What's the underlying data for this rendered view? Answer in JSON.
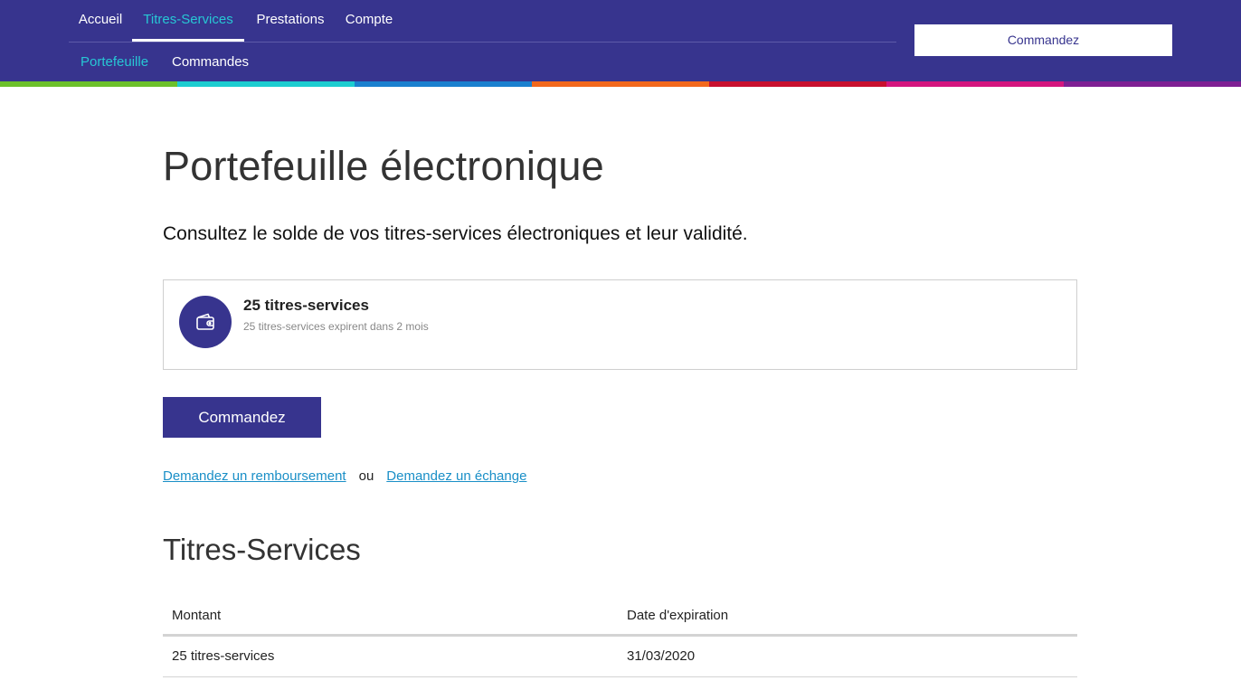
{
  "header": {
    "main_nav": [
      {
        "label": "Accueil"
      },
      {
        "label": "Titres-Services"
      },
      {
        "label": "Prestations"
      },
      {
        "label": "Compte"
      }
    ],
    "sub_nav": [
      {
        "label": "Portefeuille"
      },
      {
        "label": "Commandes"
      }
    ],
    "order_button": "Commandez",
    "active_main": "Titres-Services",
    "active_sub": "Portefeuille"
  },
  "colors": {
    "brand": "#37348e",
    "accent": "#27c7d4",
    "link": "#1a8fc7",
    "stripe": [
      "#6cc02b",
      "#1ccdd0",
      "#1a80cf",
      "#f2681c",
      "#c8102e",
      "#d4157e",
      "#7e1f93"
    ]
  },
  "main": {
    "title": "Portefeuille électronique",
    "subtitle": "Consultez le solde de vos titres-services électroniques et leur validité.",
    "balance_card": {
      "icon": "wallet-icon",
      "title": "25 titres-services",
      "subtitle": "25 titres-services expirent dans 2 mois"
    },
    "order_button": "Commandez",
    "links": {
      "refund": "Demandez un remboursement",
      "separator": "ou",
      "exchange": "Demandez un échange"
    },
    "section_title": "Titres-Services",
    "table": {
      "columns": [
        "Montant",
        "Date d'expiration"
      ],
      "rows": [
        [
          "25 titres-services",
          "31/03/2020"
        ]
      ]
    }
  }
}
